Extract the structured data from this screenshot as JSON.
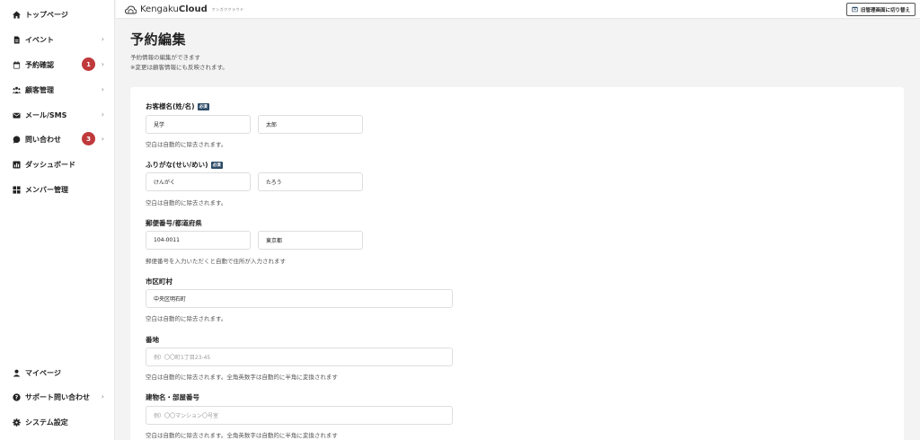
{
  "sidebar": {
    "items": [
      {
        "label": "トップページ",
        "icon": "home-icon"
      },
      {
        "label": "イベント",
        "icon": "document-icon"
      },
      {
        "label": "予約確認",
        "icon": "calendar-icon",
        "badge": "1"
      },
      {
        "label": "顧客管理",
        "icon": "users-icon"
      },
      {
        "label": "メール/SMS",
        "icon": "mail-icon"
      },
      {
        "label": "問い合わせ",
        "icon": "chat-icon",
        "badge": "3"
      },
      {
        "label": "ダッシュボード",
        "icon": "chart-icon"
      },
      {
        "label": "メンバー管理",
        "icon": "grid-icon"
      }
    ],
    "bottom_items": [
      {
        "label": "マイページ",
        "icon": "person-icon"
      },
      {
        "label": "サポート問い合わせ",
        "icon": "help-icon"
      },
      {
        "label": "システム設定",
        "icon": "gear-icon"
      }
    ]
  },
  "header": {
    "logo_light": "Kengaku",
    "logo_bold": "Cloud",
    "logo_tag": "ケンガククラウド",
    "switch_label": "旧管理画面に切り替え"
  },
  "page": {
    "title": "予約編集",
    "desc1": "予約情報の編集ができます",
    "desc2": "※変更は顧客情報にも反映されます。"
  },
  "form": {
    "required_badge": "必須",
    "name": {
      "label": "お客様名(姓/名)",
      "last": "見学",
      "first": "太郎",
      "hint": "空白は自動的に除去されます。"
    },
    "kana": {
      "label": "ふりがな(せい/めい)",
      "last": "けんがく",
      "first": "たろう",
      "hint": "空白は自動的に除去されます。"
    },
    "postal": {
      "label": "郵便番号/都道府県",
      "zip": "104-0011",
      "pref": "東京都",
      "hint": "郵便番号を入力いただくと自動で住所が入力されます"
    },
    "city": {
      "label": "市区町村",
      "value": "中央区明石町",
      "hint": "空白は自動的に除去されます。"
    },
    "street": {
      "label": "番地",
      "placeholder": "例）〇〇町1丁目23-45",
      "hint": "空白は自動的に除去されます。全角英数字は自動的に半角に変換されます"
    },
    "building": {
      "label": "建物名・部屋番号",
      "placeholder": "例）〇〇マンション〇号室",
      "hint": "空白は自動的に除去されます。全角英数字は自動的に半角に変換されます"
    }
  },
  "colors": {
    "badge": "#c0393b",
    "required": "#2c4a66",
    "background": "#f3f3f3"
  }
}
